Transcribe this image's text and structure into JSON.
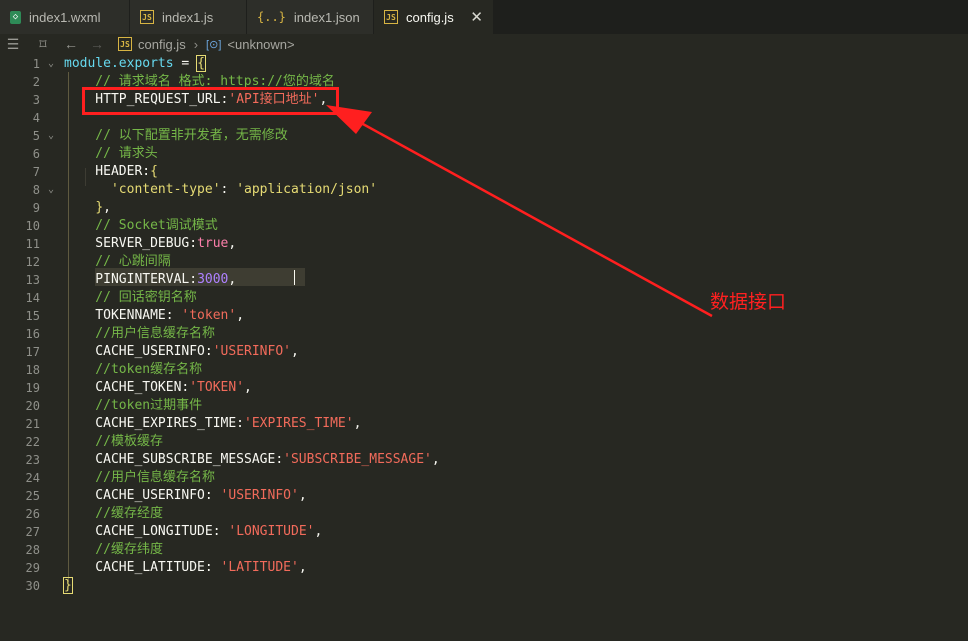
{
  "tabs": [
    {
      "name": "tab-index1-wxml",
      "icon": "wxml-file-icon",
      "label": "index1.wxml",
      "active": false
    },
    {
      "name": "tab-index1-js",
      "icon": "js-file-icon",
      "label": "index1.js",
      "active": false
    },
    {
      "name": "tab-index1-json",
      "icon": "json-file-icon",
      "label": "index1.json",
      "active": false
    },
    {
      "name": "tab-config-js",
      "icon": "js-file-icon",
      "label": "config.js",
      "active": true
    }
  ],
  "breadcrumb": {
    "file": "config.js",
    "symbol": "<unknown>"
  },
  "colors": {
    "accent": "#e6db74",
    "annotation": "#ff1f1f",
    "background": "#272822"
  },
  "line_numbers": [
    "1",
    "2",
    "3",
    "4",
    "5",
    "6",
    "7",
    "8",
    "9",
    "10",
    "11",
    "12",
    "13",
    "14",
    "15",
    "16",
    "17",
    "18",
    "19",
    "20",
    "21",
    "22",
    "23",
    "24",
    "25",
    "26",
    "27",
    "28",
    "29",
    "30"
  ],
  "code_lines": [
    [
      {
        "t": "module.exports",
        "c": "kw"
      },
      {
        "t": " = ",
        "c": "p"
      },
      {
        "t": "{",
        "c": "brace brace-box"
      }
    ],
    [
      {
        "t": "    // 请求域名 格式: https://您的域名",
        "c": "cm"
      }
    ],
    [
      {
        "t": "    HTTP_REQUEST_URL:",
        "c": "p"
      },
      {
        "t": "'API接口地址'",
        "c": "str2"
      },
      {
        "t": ",",
        "c": "p"
      }
    ],
    [],
    [
      {
        "t": "    // 以下配置非开发者，无需修改",
        "c": "cm"
      }
    ],
    [
      {
        "t": "    // 请求头",
        "c": "cm"
      }
    ],
    [
      {
        "t": "    HEADER:",
        "c": "p"
      },
      {
        "t": "{",
        "c": "brace"
      }
    ],
    [
      {
        "t": "      'content-type'",
        "c": "str"
      },
      {
        "t": ": ",
        "c": "p"
      },
      {
        "t": "'application/json'",
        "c": "str"
      }
    ],
    [
      {
        "t": "    ",
        "c": "p"
      },
      {
        "t": "}",
        "c": "brace"
      },
      {
        "t": ",",
        "c": "p"
      }
    ],
    [
      {
        "t": "    // Socket调试模式",
        "c": "cm"
      }
    ],
    [
      {
        "t": "    SERVER_DEBUG:",
        "c": "p"
      },
      {
        "t": "true",
        "c": "bool"
      },
      {
        "t": ",",
        "c": "p"
      }
    ],
    [
      {
        "t": "    // 心跳间隔",
        "c": "cm"
      }
    ],
    [
      {
        "t": "    PINGINTERVAL:",
        "c": "p"
      },
      {
        "t": "3000",
        "c": "num"
      },
      {
        "t": ",",
        "c": "p"
      }
    ],
    [
      {
        "t": "    // 回话密钥名称",
        "c": "cm"
      }
    ],
    [
      {
        "t": "    TOKENNAME: ",
        "c": "p"
      },
      {
        "t": "'token'",
        "c": "str2"
      },
      {
        "t": ",",
        "c": "p"
      }
    ],
    [
      {
        "t": "    //用户信息缓存名称",
        "c": "cm"
      }
    ],
    [
      {
        "t": "    CACHE_USERINFO:",
        "c": "p"
      },
      {
        "t": "'USERINFO'",
        "c": "str2"
      },
      {
        "t": ",",
        "c": "p"
      }
    ],
    [
      {
        "t": "    //token缓存名称",
        "c": "cm"
      }
    ],
    [
      {
        "t": "    CACHE_TOKEN:",
        "c": "p"
      },
      {
        "t": "'TOKEN'",
        "c": "str2"
      },
      {
        "t": ",",
        "c": "p"
      }
    ],
    [
      {
        "t": "    //token过期事件",
        "c": "cm"
      }
    ],
    [
      {
        "t": "    CACHE_EXPIRES_TIME:",
        "c": "p"
      },
      {
        "t": "'EXPIRES_TIME'",
        "c": "str2"
      },
      {
        "t": ",",
        "c": "p"
      }
    ],
    [
      {
        "t": "    //模板缓存",
        "c": "cm"
      }
    ],
    [
      {
        "t": "    CACHE_SUBSCRIBE_MESSAGE:",
        "c": "p"
      },
      {
        "t": "'SUBSCRIBE_MESSAGE'",
        "c": "str2"
      },
      {
        "t": ",",
        "c": "p"
      }
    ],
    [
      {
        "t": "    //用户信息缓存名称",
        "c": "cm"
      }
    ],
    [
      {
        "t": "    CACHE_USERINFO: ",
        "c": "p"
      },
      {
        "t": "'USERINFO'",
        "c": "str2"
      },
      {
        "t": ",",
        "c": "p"
      }
    ],
    [
      {
        "t": "    //缓存经度",
        "c": "cm"
      }
    ],
    [
      {
        "t": "    CACHE_LONGITUDE: ",
        "c": "p"
      },
      {
        "t": "'LONGITUDE'",
        "c": "str2"
      },
      {
        "t": ",",
        "c": "p"
      }
    ],
    [
      {
        "t": "    //缓存纬度",
        "c": "cm"
      }
    ],
    [
      {
        "t": "    CACHE_LATITUDE: ",
        "c": "p"
      },
      {
        "t": "'LATITUDE'",
        "c": "str2"
      },
      {
        "t": ",",
        "c": "p"
      }
    ],
    [
      {
        "t": "}",
        "c": "brace brace-box"
      }
    ]
  ],
  "fold_markers": [
    "1",
    "5",
    "8"
  ],
  "annotation": {
    "label": "数据接口"
  }
}
